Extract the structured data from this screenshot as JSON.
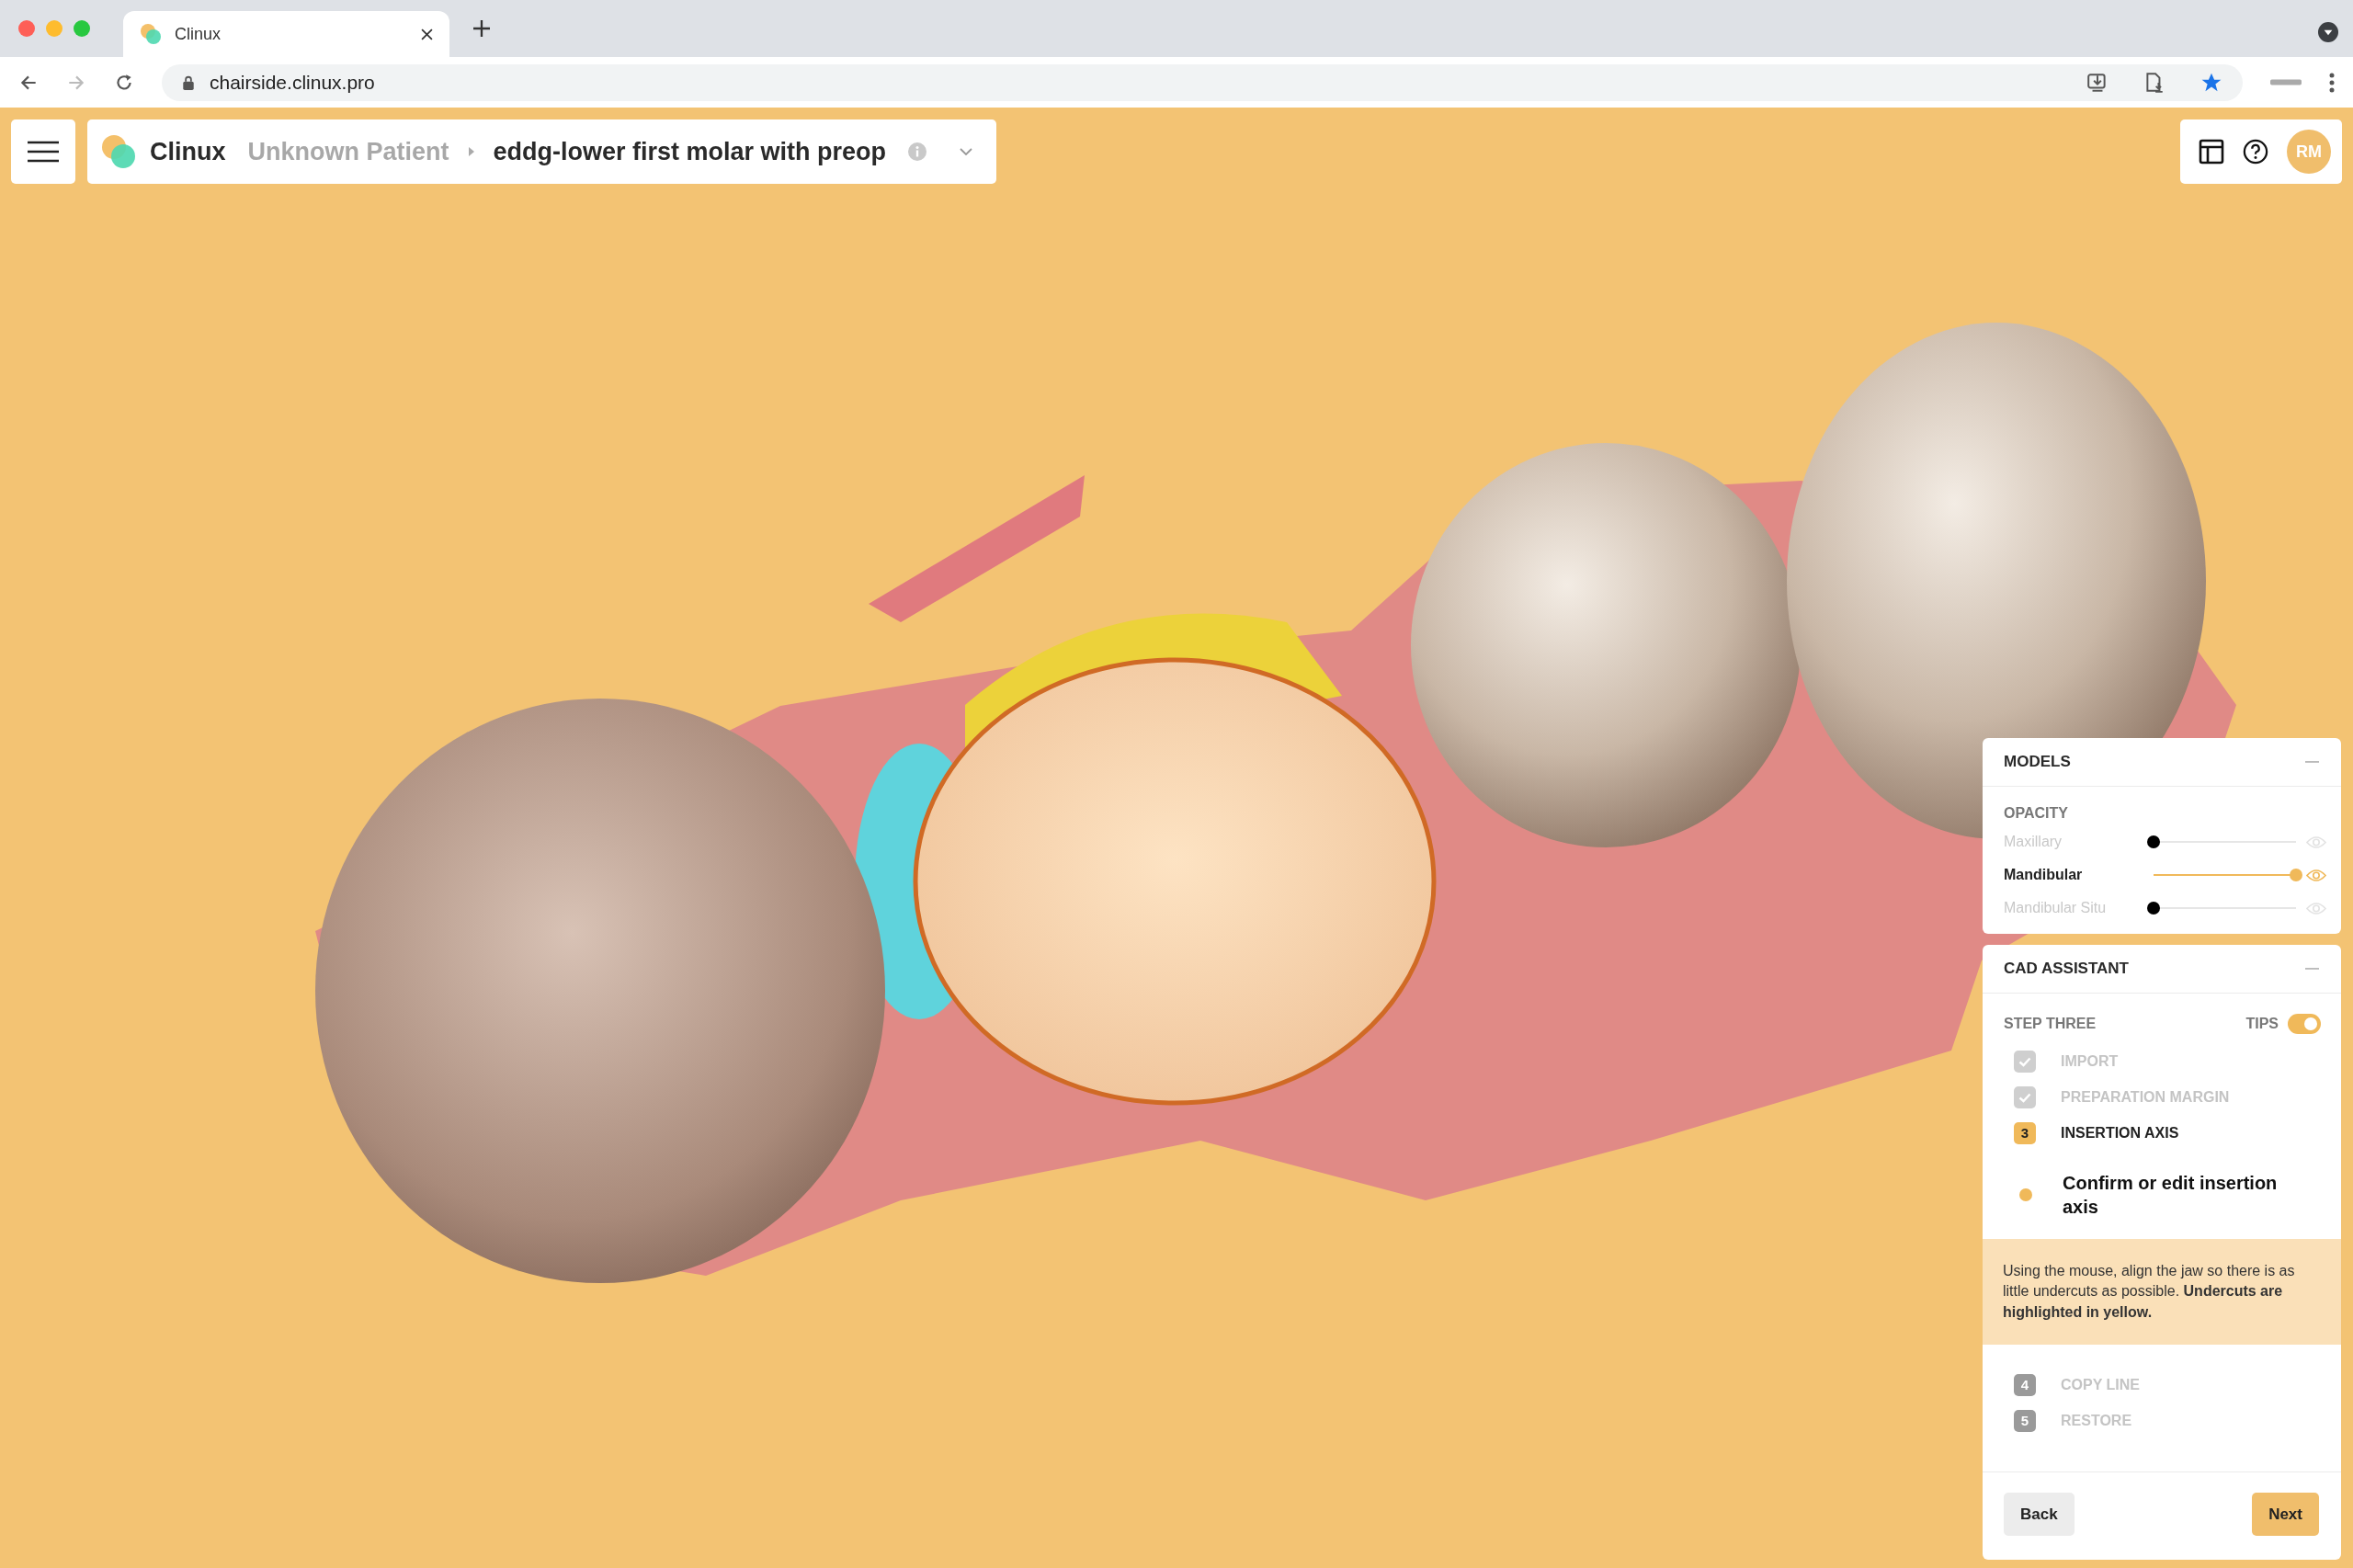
{
  "browser": {
    "tab": {
      "title": "Clinux"
    },
    "url": "chairside.clinux.pro"
  },
  "header": {
    "brand": "Clinux",
    "patient": "Unknown Patient",
    "case": "eddg-lower first molar with preop",
    "avatar": "RM"
  },
  "models_panel": {
    "title": "MODELS",
    "section": "OPACITY",
    "layers": [
      {
        "name": "Maxillary",
        "visible": false,
        "level": 0
      },
      {
        "name": "Mandibular",
        "visible": true,
        "level": 1
      },
      {
        "name": "Mandibular Situ",
        "visible": false,
        "level": 0
      }
    ]
  },
  "cad_assistant": {
    "title": "CAD ASSISTANT",
    "step_title": "STEP THREE",
    "tips": {
      "label": "TIPS",
      "on": true
    },
    "steps": [
      {
        "kind": "done",
        "label": "IMPORT"
      },
      {
        "kind": "done",
        "label": "PREPARATION MARGIN"
      },
      {
        "kind": "current",
        "number": "3",
        "label": "INSERTION AXIS",
        "task": "Confirm or edit insertion axis",
        "tip": "Using the mouse, align the jaw so there is as little undercuts as possible. **Undercuts are highlighted in yellow.**"
      },
      {
        "kind": "pending",
        "number": "4",
        "label": "COPY LINE"
      },
      {
        "kind": "pending",
        "number": "5",
        "label": "RESTORE"
      }
    ],
    "buttons": {
      "back": "Back",
      "next": "Next"
    }
  }
}
